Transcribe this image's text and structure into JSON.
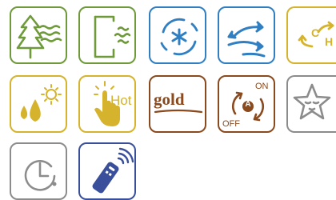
{
  "colors": {
    "green": "#6e9a3a",
    "blue": "#2f7fc2",
    "yellow": "#d6b32c",
    "brown": "#8a4a1e",
    "gray": "#8c8c8c",
    "navy": "#3a4f9b"
  },
  "tiles": [
    {
      "icon": "pine-tree-airflow-icon"
    },
    {
      "icon": "air-filter-icon"
    },
    {
      "icon": "ion-fan-icon"
    },
    {
      "icon": "swing-airflow-icon"
    },
    {
      "icon": "cool-heat-switch-icon",
      "cool_label": "C",
      "heat_label": "H"
    },
    {
      "icon": "dehumidify-sun-icon"
    },
    {
      "icon": "hot-touch-icon",
      "label": "Hot"
    },
    {
      "icon": "gold-fin-icon",
      "label": "gold"
    },
    {
      "icon": "auto-on-off-icon",
      "on_label": "ON",
      "off_label": "OFF",
      "auto_label": "A"
    },
    {
      "icon": "sleep-star-icon"
    },
    {
      "icon": "timer-clock-icon"
    },
    {
      "icon": "remote-control-icon"
    }
  ]
}
